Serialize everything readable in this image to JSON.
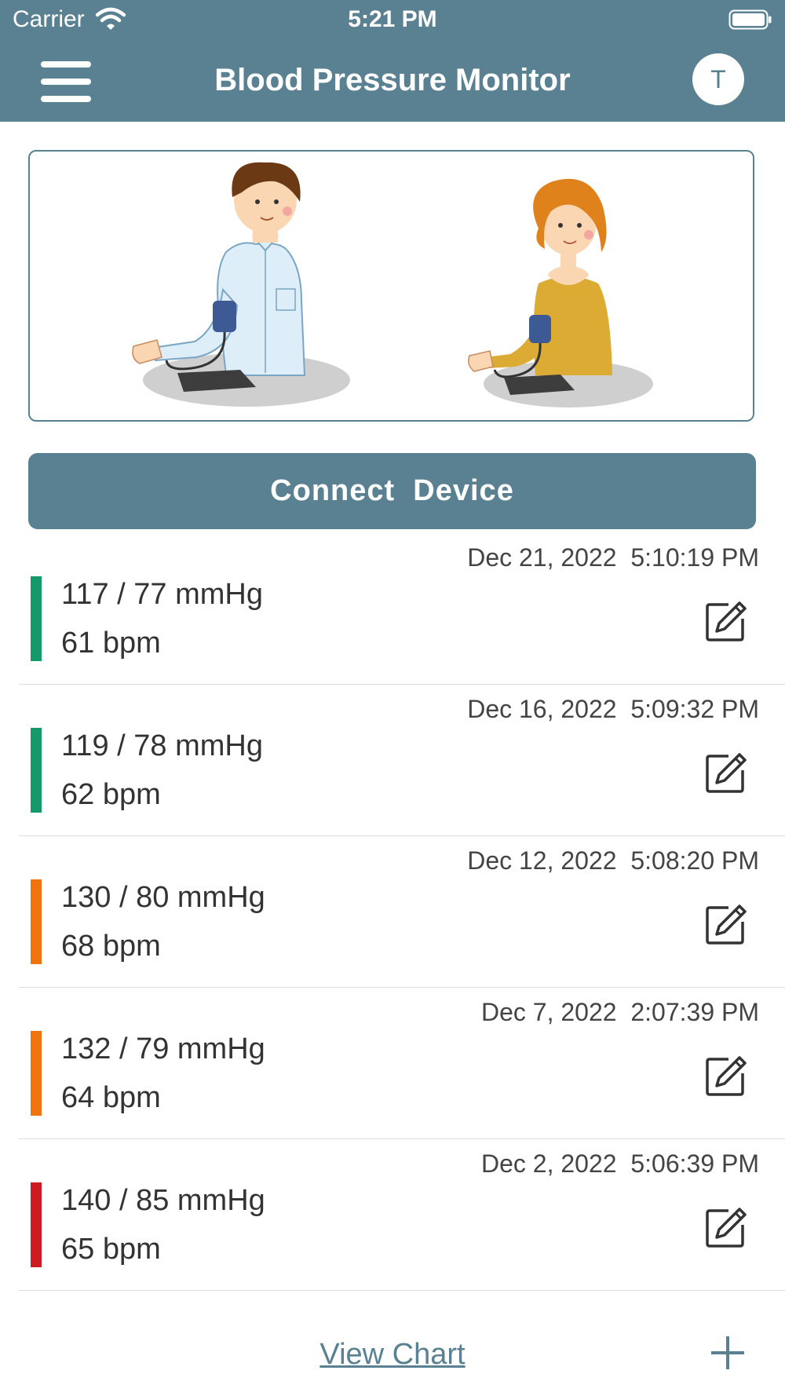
{
  "status_bar": {
    "carrier": "Carrier",
    "time": "5:21 PM"
  },
  "header": {
    "title": "Blood Pressure Monitor",
    "avatar_initial": "T"
  },
  "connect_button": {
    "label": "Connect  Device"
  },
  "colors": {
    "header": "#5a8192",
    "normal": "#14996a",
    "elevated": "#ee7410",
    "high": "#cc1b22"
  },
  "readings": [
    {
      "timestamp": "Dec 21, 2022  5:10:19 PM",
      "pressure": "117 / 77 mmHg",
      "pulse": "61 bpm",
      "status_color": "#14996a"
    },
    {
      "timestamp": "Dec 16, 2022  5:09:32 PM",
      "pressure": "119 / 78 mmHg",
      "pulse": "62 bpm",
      "status_color": "#14996a"
    },
    {
      "timestamp": "Dec 12, 2022  5:08:20 PM",
      "pressure": "130 / 80 mmHg",
      "pulse": "68 bpm",
      "status_color": "#ee7410"
    },
    {
      "timestamp": "Dec 7, 2022  2:07:39 PM",
      "pressure": "132 / 79 mmHg",
      "pulse": "64 bpm",
      "status_color": "#ee7410"
    },
    {
      "timestamp": "Dec 2, 2022  5:06:39 PM",
      "pressure": "140 / 85 mmHg",
      "pulse": "65 bpm",
      "status_color": "#cc1b22"
    }
  ],
  "footer": {
    "view_chart_label": "View Chart"
  }
}
